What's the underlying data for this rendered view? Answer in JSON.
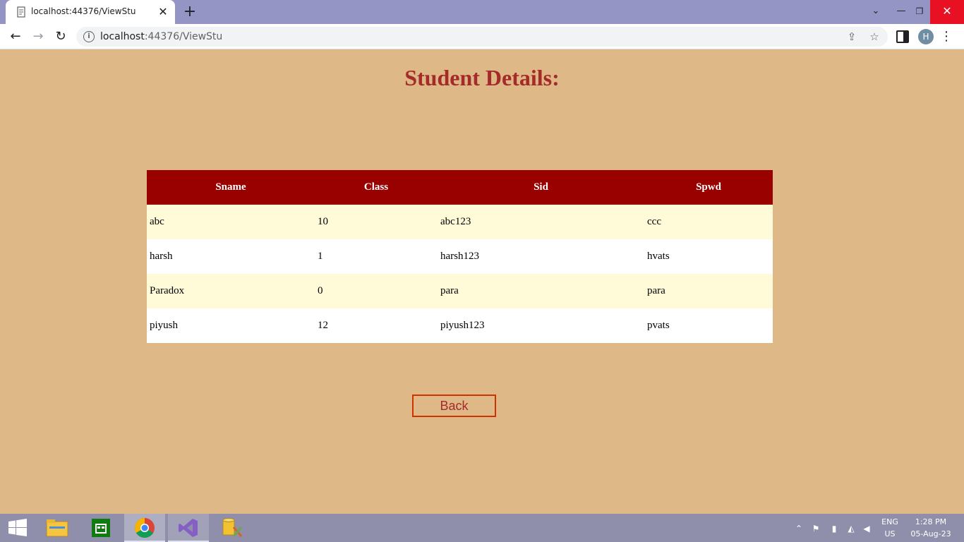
{
  "browser": {
    "tab_title": "localhost:44376/ViewStu",
    "tab_close": "✕",
    "new_tab": "+",
    "url_host": "localhost",
    "url_rest": ":44376/ViewStu",
    "profile_initial": "H",
    "window_controls": {
      "chevron": "⌄",
      "minimize": "—",
      "maximize": "❐",
      "close": "✕"
    }
  },
  "page": {
    "heading": "Student Details:",
    "table": {
      "columns": [
        "Sname",
        "Class",
        "Sid",
        "Spwd"
      ],
      "rows": [
        [
          "abc",
          "10",
          "abc123",
          "ccc"
        ],
        [
          "harsh",
          "1",
          "harsh123",
          "hvats"
        ],
        [
          "Paradox",
          "0",
          "para",
          "para"
        ],
        [
          "piyush",
          "12",
          "piyush123",
          "pvats"
        ]
      ]
    },
    "back_label": "Back"
  },
  "colors": {
    "page_background": "#deb887",
    "heading": "#a52a2a",
    "header_background": "#990000",
    "row_odd": "#fffad8",
    "row_even": "#ffffff",
    "button_border": "#cc3300"
  },
  "taskbar": {
    "apps": [
      "start-icon",
      "file-explorer-icon",
      "store-icon",
      "chrome-icon",
      "visual-studio-icon",
      "sql-tool-icon"
    ],
    "lang_top": "ENG",
    "lang_bottom": "US",
    "time": "1:28 PM",
    "date": "05-Aug-23"
  }
}
